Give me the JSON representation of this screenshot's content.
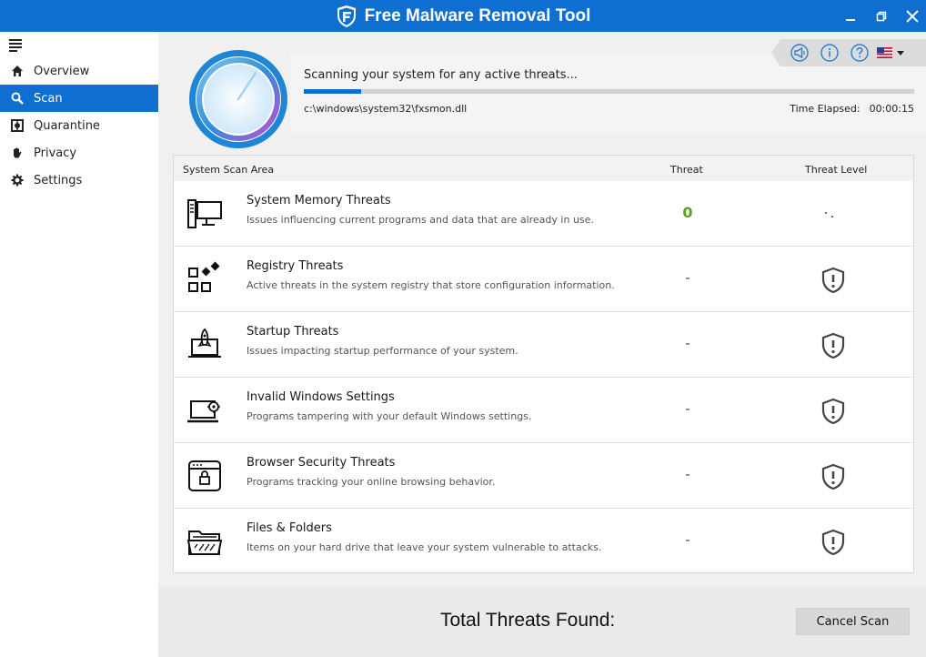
{
  "app": {
    "title": "Free Malware Removal Tool"
  },
  "colors": {
    "accent": "#0e6fd0",
    "threat_zero": "#5aa31d"
  },
  "sidebar": {
    "items": [
      {
        "label": "Overview",
        "icon": "home-icon"
      },
      {
        "label": "Scan",
        "icon": "search-icon",
        "active": true
      },
      {
        "label": "Quarantine",
        "icon": "quarantine-icon"
      },
      {
        "label": "Privacy",
        "icon": "hand-icon"
      },
      {
        "label": "Settings",
        "icon": "gear-icon"
      }
    ]
  },
  "scan": {
    "status": "Scanning your system for any active threats...",
    "progress_fraction": 0.094,
    "current_file": "c:\\windows\\system32\\fxsmon.dll",
    "elapsed_label": "Time Elapsed:",
    "elapsed_value": "00:00:15"
  },
  "toolbar": {
    "icons": [
      "megaphone-icon",
      "info-icon",
      "help-icon",
      "us-flag-icon"
    ]
  },
  "table": {
    "headers": {
      "area": "System Scan Area",
      "threat": "Threat",
      "level": "Threat Level"
    },
    "rows": [
      {
        "title": "System Memory Threats",
        "desc": "Issues influencing current programs and data that are already in use.",
        "threat": "0",
        "icon": "computer-memory-icon",
        "level": "scanning"
      },
      {
        "title": "Registry Threats",
        "desc": "Active threats in the system registry that store configuration information.",
        "threat": "-",
        "icon": "registry-blocks-icon",
        "level": "shield"
      },
      {
        "title": "Startup Threats",
        "desc": "Issues impacting startup performance of your system.",
        "threat": "-",
        "icon": "rocket-laptop-icon",
        "level": "shield"
      },
      {
        "title": "Invalid Windows Settings",
        "desc": "Programs tampering with your default Windows settings.",
        "threat": "-",
        "icon": "laptop-gear-icon",
        "level": "shield"
      },
      {
        "title": "Browser Security Threats",
        "desc": "Programs tracking your online browsing behavior.",
        "threat": "-",
        "icon": "browser-lock-icon",
        "level": "shield"
      },
      {
        "title": "Files & Folders",
        "desc": "Items on your hard drive that leave your system vulnerable to attacks.",
        "threat": "-",
        "icon": "folder-icon",
        "level": "shield"
      }
    ]
  },
  "footer": {
    "total_label": "Total Threats Found:",
    "cancel_label": "Cancel Scan"
  }
}
